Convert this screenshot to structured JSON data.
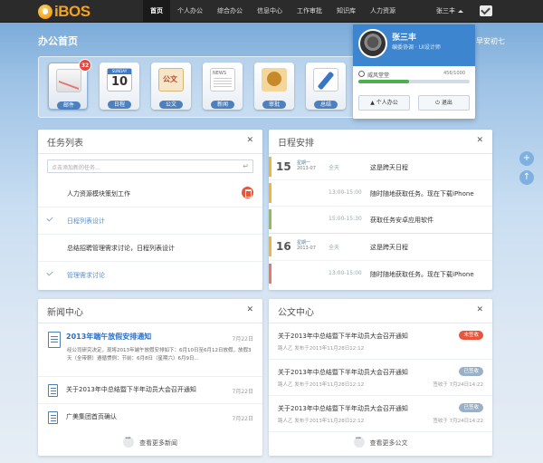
{
  "brand": {
    "logo_text": "iBOS"
  },
  "nav": {
    "items": [
      "首页",
      "个人办公",
      "综合办公",
      "信息中心",
      "工作审批",
      "知识库",
      "人力资源"
    ],
    "active_index": 0
  },
  "user": {
    "name": "张三丰"
  },
  "page": {
    "title": "办公首页",
    "title_right": "早安初七"
  },
  "apps": [
    {
      "label": "邮件",
      "icon": "mail-icon",
      "badge": "32",
      "selected": true
    },
    {
      "label": "日程",
      "icon": "calendar-icon",
      "calendar_header": "SUNDAY",
      "calendar_day": "10"
    },
    {
      "label": "公文",
      "icon": "document-icon",
      "doc_char": "公文"
    },
    {
      "label": "新闻",
      "icon": "news-icon",
      "news_text": "NEWS"
    },
    {
      "label": "审批",
      "icon": "stamp-icon"
    },
    {
      "label": "总结",
      "icon": "pen-icon"
    }
  ],
  "profile": {
    "name": "张三丰",
    "role": "编委协调 · UI设计师",
    "rank_label": "威风堂堂",
    "rank_value": "456/1000",
    "progress": 0.456,
    "btn_personal": "个人办公",
    "btn_logout": "退出"
  },
  "tasks": {
    "title": "任务列表",
    "input_placeholder": "点击添加新的任务...",
    "items": [
      {
        "text": "人力资源模块策划工作",
        "done": false,
        "has_delete": true
      },
      {
        "text": "日程列表设计",
        "done": true
      },
      {
        "text": "总结招聘管理需求讨论，日程列表设计",
        "done": false
      },
      {
        "text": "管理需求讨论",
        "done": true
      }
    ]
  },
  "schedule": {
    "title": "日程安排",
    "days": [
      {
        "day": "15",
        "week": "星期一",
        "month": "2013-07",
        "entries": [
          {
            "time": "全天",
            "event": "这是跨天日程",
            "color": "#f4b43a"
          },
          {
            "time": "13:00-15:00",
            "event": "随时随地获取任务。现在下载iPhone",
            "color": "#f4b43a"
          },
          {
            "time": "15:00-15:30",
            "event": "获取任务安卓应用软件",
            "color": "#8cc152"
          }
        ]
      },
      {
        "day": "16",
        "week": "星期一",
        "month": "2013-07",
        "entries": [
          {
            "time": "全天",
            "event": "这是跨天日程",
            "color": "#f4b43a"
          },
          {
            "time": "13:00-15:00",
            "event": "随时随地获取任务。现在下载iPhone",
            "color": "#e9786a"
          }
        ]
      }
    ]
  },
  "news": {
    "title": "新闻中心",
    "featured": {
      "title": "2013年端午放假安排通知",
      "date": "7月22日",
      "desc": "经公司研究决定，现将2013年端午放假安排如下：6月10日至6月12日放假，放假3天（全带薪）遵循惯例：节前：6月8日（星期六）6月9日..."
    },
    "items": [
      {
        "title": "关于2013年中总结暨下半年动员大会召开通知",
        "date": "7月22日"
      },
      {
        "title": "广美集团首页确认",
        "date": "7月22日"
      }
    ],
    "more_label": "查看更多新闻"
  },
  "docs": {
    "title": "公文中心",
    "items": [
      {
        "title": "关于2013年中总结暨下半年动员大会召开通知",
        "meta": "路人乙 发布于2013年11月28日12:12",
        "status": "未签收",
        "status_color": "#e8553a",
        "right_meta": ""
      },
      {
        "title": "关于2013年中总结暨下半年动员大会召开通知",
        "meta": "路人乙 发布于2013年11月28日12:12",
        "status": "已签收",
        "status_color": "#9ab0c6",
        "right_meta": "签收于 7月24日14:22"
      },
      {
        "title": "关于2013年中总结暨下半年动员大会召开通知",
        "meta": "路人乙 发布于2013年11月28日12:12",
        "status": "已签收",
        "status_color": "#9ab0c6",
        "right_meta": "签收于 7月24日14:22"
      }
    ],
    "more_label": "查看更多公文"
  },
  "float": {
    "add": "+",
    "top": "↑"
  }
}
